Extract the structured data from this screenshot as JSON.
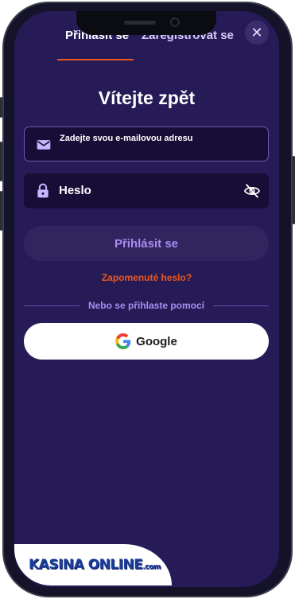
{
  "tabs": {
    "login": "Přihlásit se",
    "register": "Zaregistrovat se"
  },
  "close_icon": "✕",
  "title": "Vítejte zpět",
  "email": {
    "placeholder": "Zadejte svou e-mailovou adresu",
    "icon": "envelope-icon"
  },
  "password": {
    "value": "Heslo",
    "icon": "lock-icon",
    "toggle_icon": "eye-off-icon"
  },
  "login_button": "Přihlásit se",
  "forgot_link": "Zapomenuté heslo?",
  "divider_text": "Nebo se přihlaste pomocí",
  "google_button": "Google",
  "brand": {
    "name": "KASINA ONLINE",
    "domain": ".com"
  },
  "colors": {
    "background": "#271b57",
    "accent": "#e8581e",
    "field": "#170d36",
    "muted_purple": "#a78ef0"
  }
}
